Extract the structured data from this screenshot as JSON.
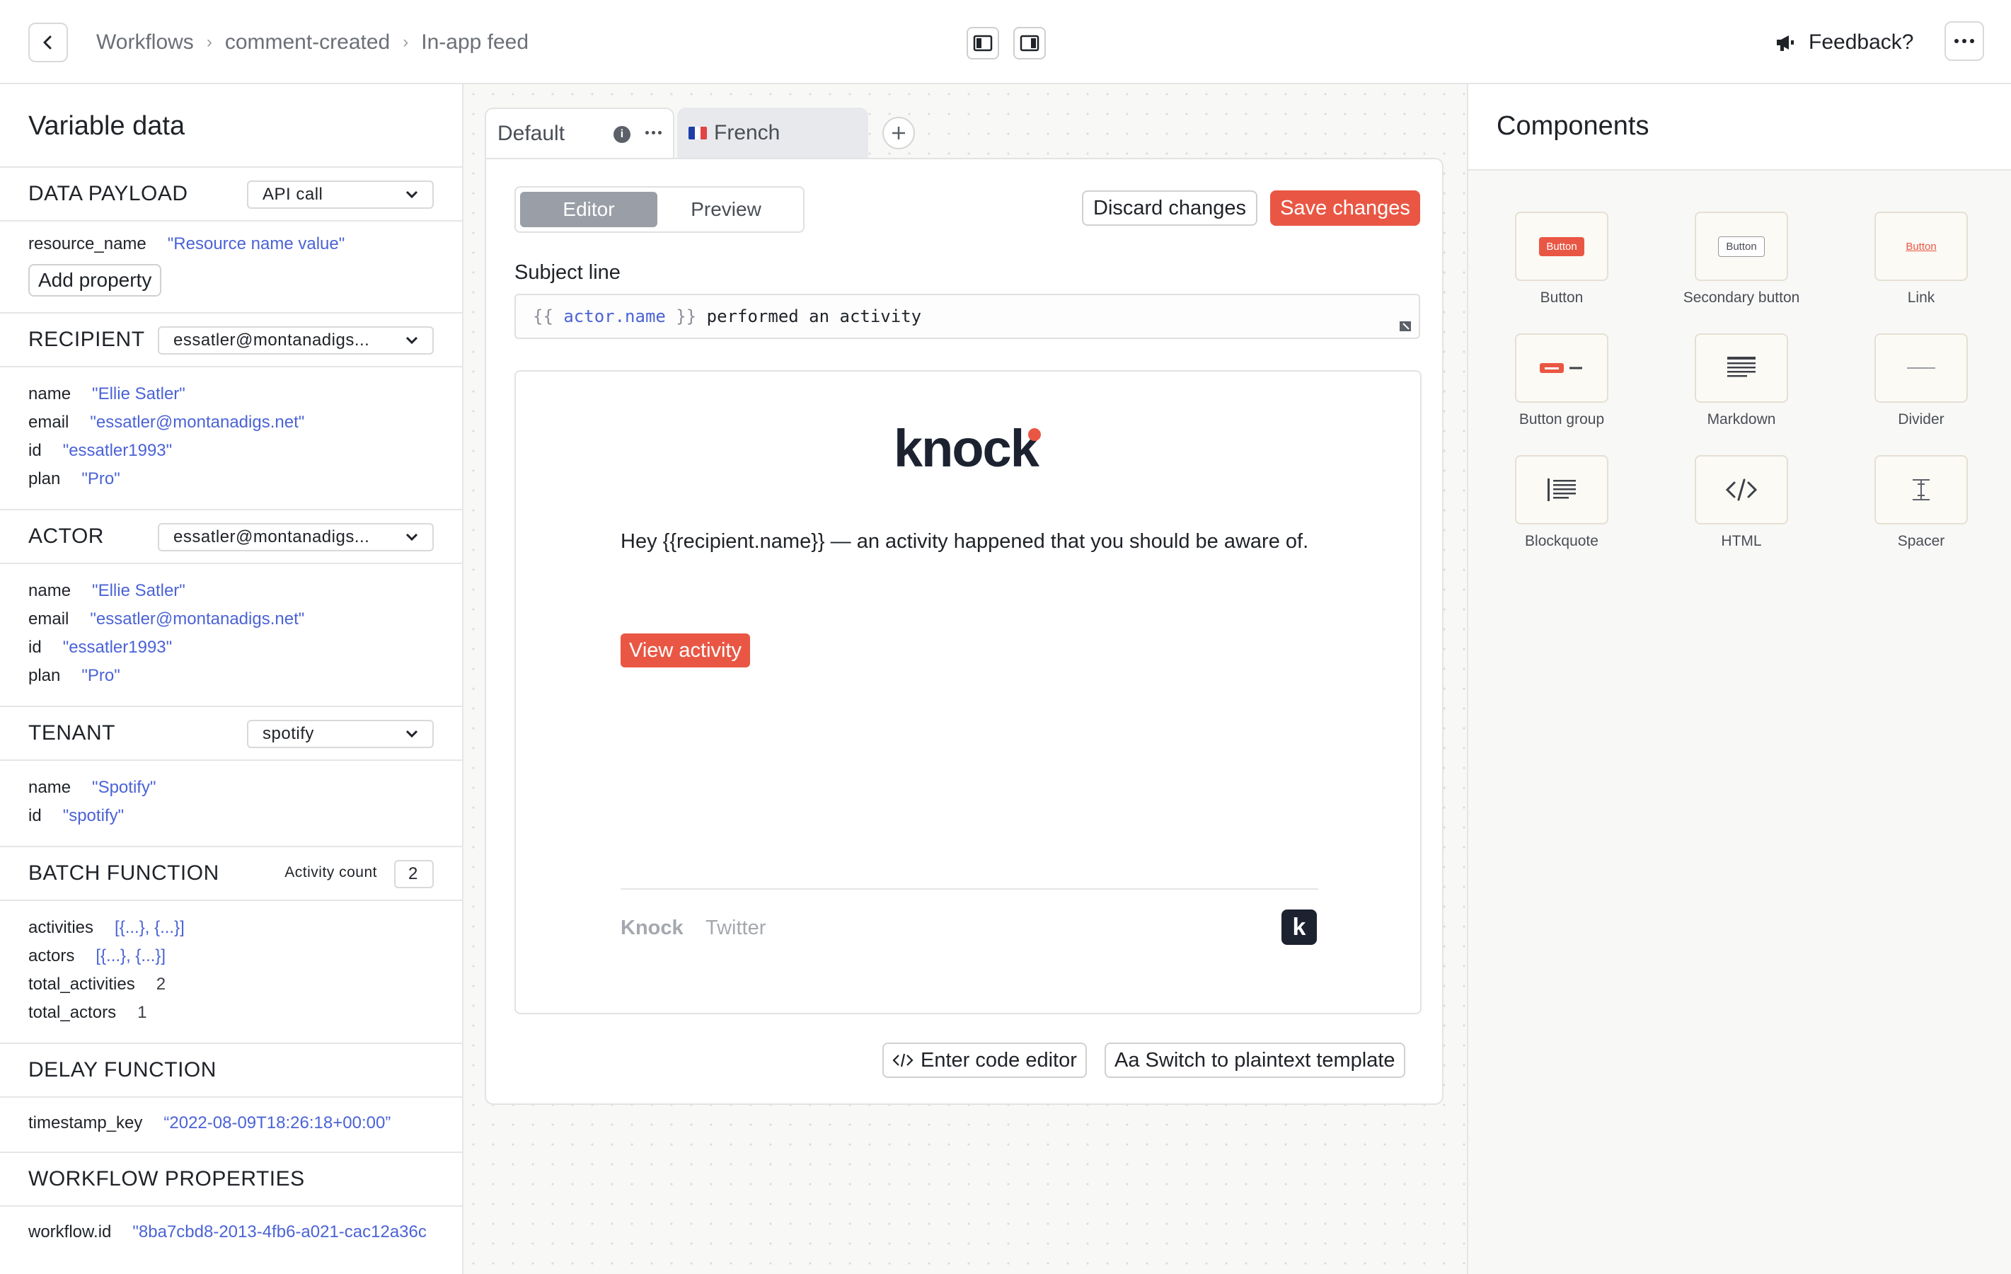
{
  "header": {
    "breadcrumb": [
      "Workflows",
      "comment-created",
      "In-app feed"
    ],
    "feedback_label": "Feedback?"
  },
  "left": {
    "title": "Variable data",
    "data_payload": {
      "heading": "DATA PAYLOAD",
      "select": "API call",
      "rows": [
        {
          "key": "resource_name",
          "value": "\"Resource name value\""
        }
      ],
      "add_property": "Add property"
    },
    "recipient": {
      "heading": "RECIPIENT",
      "select": "essatler@montanadigs...",
      "rows": [
        {
          "key": "name",
          "value": "\"Ellie Satler\""
        },
        {
          "key": "email",
          "value": "\"essatler@montanadigs.net\""
        },
        {
          "key": "id",
          "value": "\"essatler1993\""
        },
        {
          "key": "plan",
          "value": "\"Pro\""
        }
      ]
    },
    "actor": {
      "heading": "ACTOR",
      "select": "essatler@montanadigs...",
      "rows": [
        {
          "key": "name",
          "value": "\"Ellie Satler\""
        },
        {
          "key": "email",
          "value": "\"essatler@montanadigs.net\""
        },
        {
          "key": "id",
          "value": "\"essatler1993\""
        },
        {
          "key": "plan",
          "value": "\"Pro\""
        }
      ]
    },
    "tenant": {
      "heading": "TENANT",
      "select": "spotify",
      "rows": [
        {
          "key": "name",
          "value": "\"Spotify\""
        },
        {
          "key": "id",
          "value": "\"spotify\""
        }
      ]
    },
    "batch": {
      "heading": "BATCH FUNCTION",
      "count_label": "Activity count",
      "count_value": "2",
      "rows": [
        {
          "key": "activities",
          "value": "[{...}, {...}]"
        },
        {
          "key": "actors",
          "value": "[{...}, {...}]"
        },
        {
          "key": "total_activities",
          "value": "2"
        },
        {
          "key": "total_actors",
          "value": "1"
        }
      ]
    },
    "delay": {
      "heading": "DELAY FUNCTION",
      "rows": [
        {
          "key": "timestamp_key",
          "value": "“2022-08-09T18:26:18+00:00”"
        }
      ]
    },
    "workflow": {
      "heading": "WORKFLOW PROPERTIES",
      "rows": [
        {
          "key": "workflow.id",
          "value": "\"8ba7cbd8-2013-4fb6-a021-cac12a36c"
        }
      ]
    }
  },
  "editor": {
    "tabs": [
      {
        "label": "Default"
      },
      {
        "label": "French"
      }
    ],
    "segments": [
      "Editor",
      "Preview"
    ],
    "discard_label": "Discard changes",
    "save_label": "Save changes",
    "subject_label": "Subject line",
    "subject": {
      "open": "{{ ",
      "var": "actor.name",
      "close": " }}",
      "rest": " performed an activity"
    },
    "preview": {
      "logo": "knock",
      "message": "Hey {{recipient.name}} — an activity happened that you should be aware of.",
      "button": "View activity",
      "footer_links": [
        "Knock",
        "Twitter"
      ],
      "badge": "k"
    },
    "code_editor_label": "Enter code editor",
    "plaintext_label": "Aa Switch to plaintext template"
  },
  "components": {
    "title": "Components",
    "items": [
      {
        "label": "Button",
        "icon": "button-icon",
        "sample": "Button"
      },
      {
        "label": "Secondary button",
        "icon": "secondary-button-icon",
        "sample": "Button"
      },
      {
        "label": "Link",
        "icon": "link-icon",
        "sample": "Button"
      },
      {
        "label": "Button group",
        "icon": "button-group-icon"
      },
      {
        "label": "Markdown",
        "icon": "markdown-icon"
      },
      {
        "label": "Divider",
        "icon": "divider-icon"
      },
      {
        "label": "Blockquote",
        "icon": "blockquote-icon"
      },
      {
        "label": "HTML",
        "icon": "code-icon"
      },
      {
        "label": "Spacer",
        "icon": "spacer-icon"
      }
    ]
  },
  "colors": {
    "accent": "#e95744",
    "variable_blue": "#4b63d6",
    "french_flag": [
      "#1f3fa8",
      "#ffffff",
      "#e24343"
    ]
  }
}
